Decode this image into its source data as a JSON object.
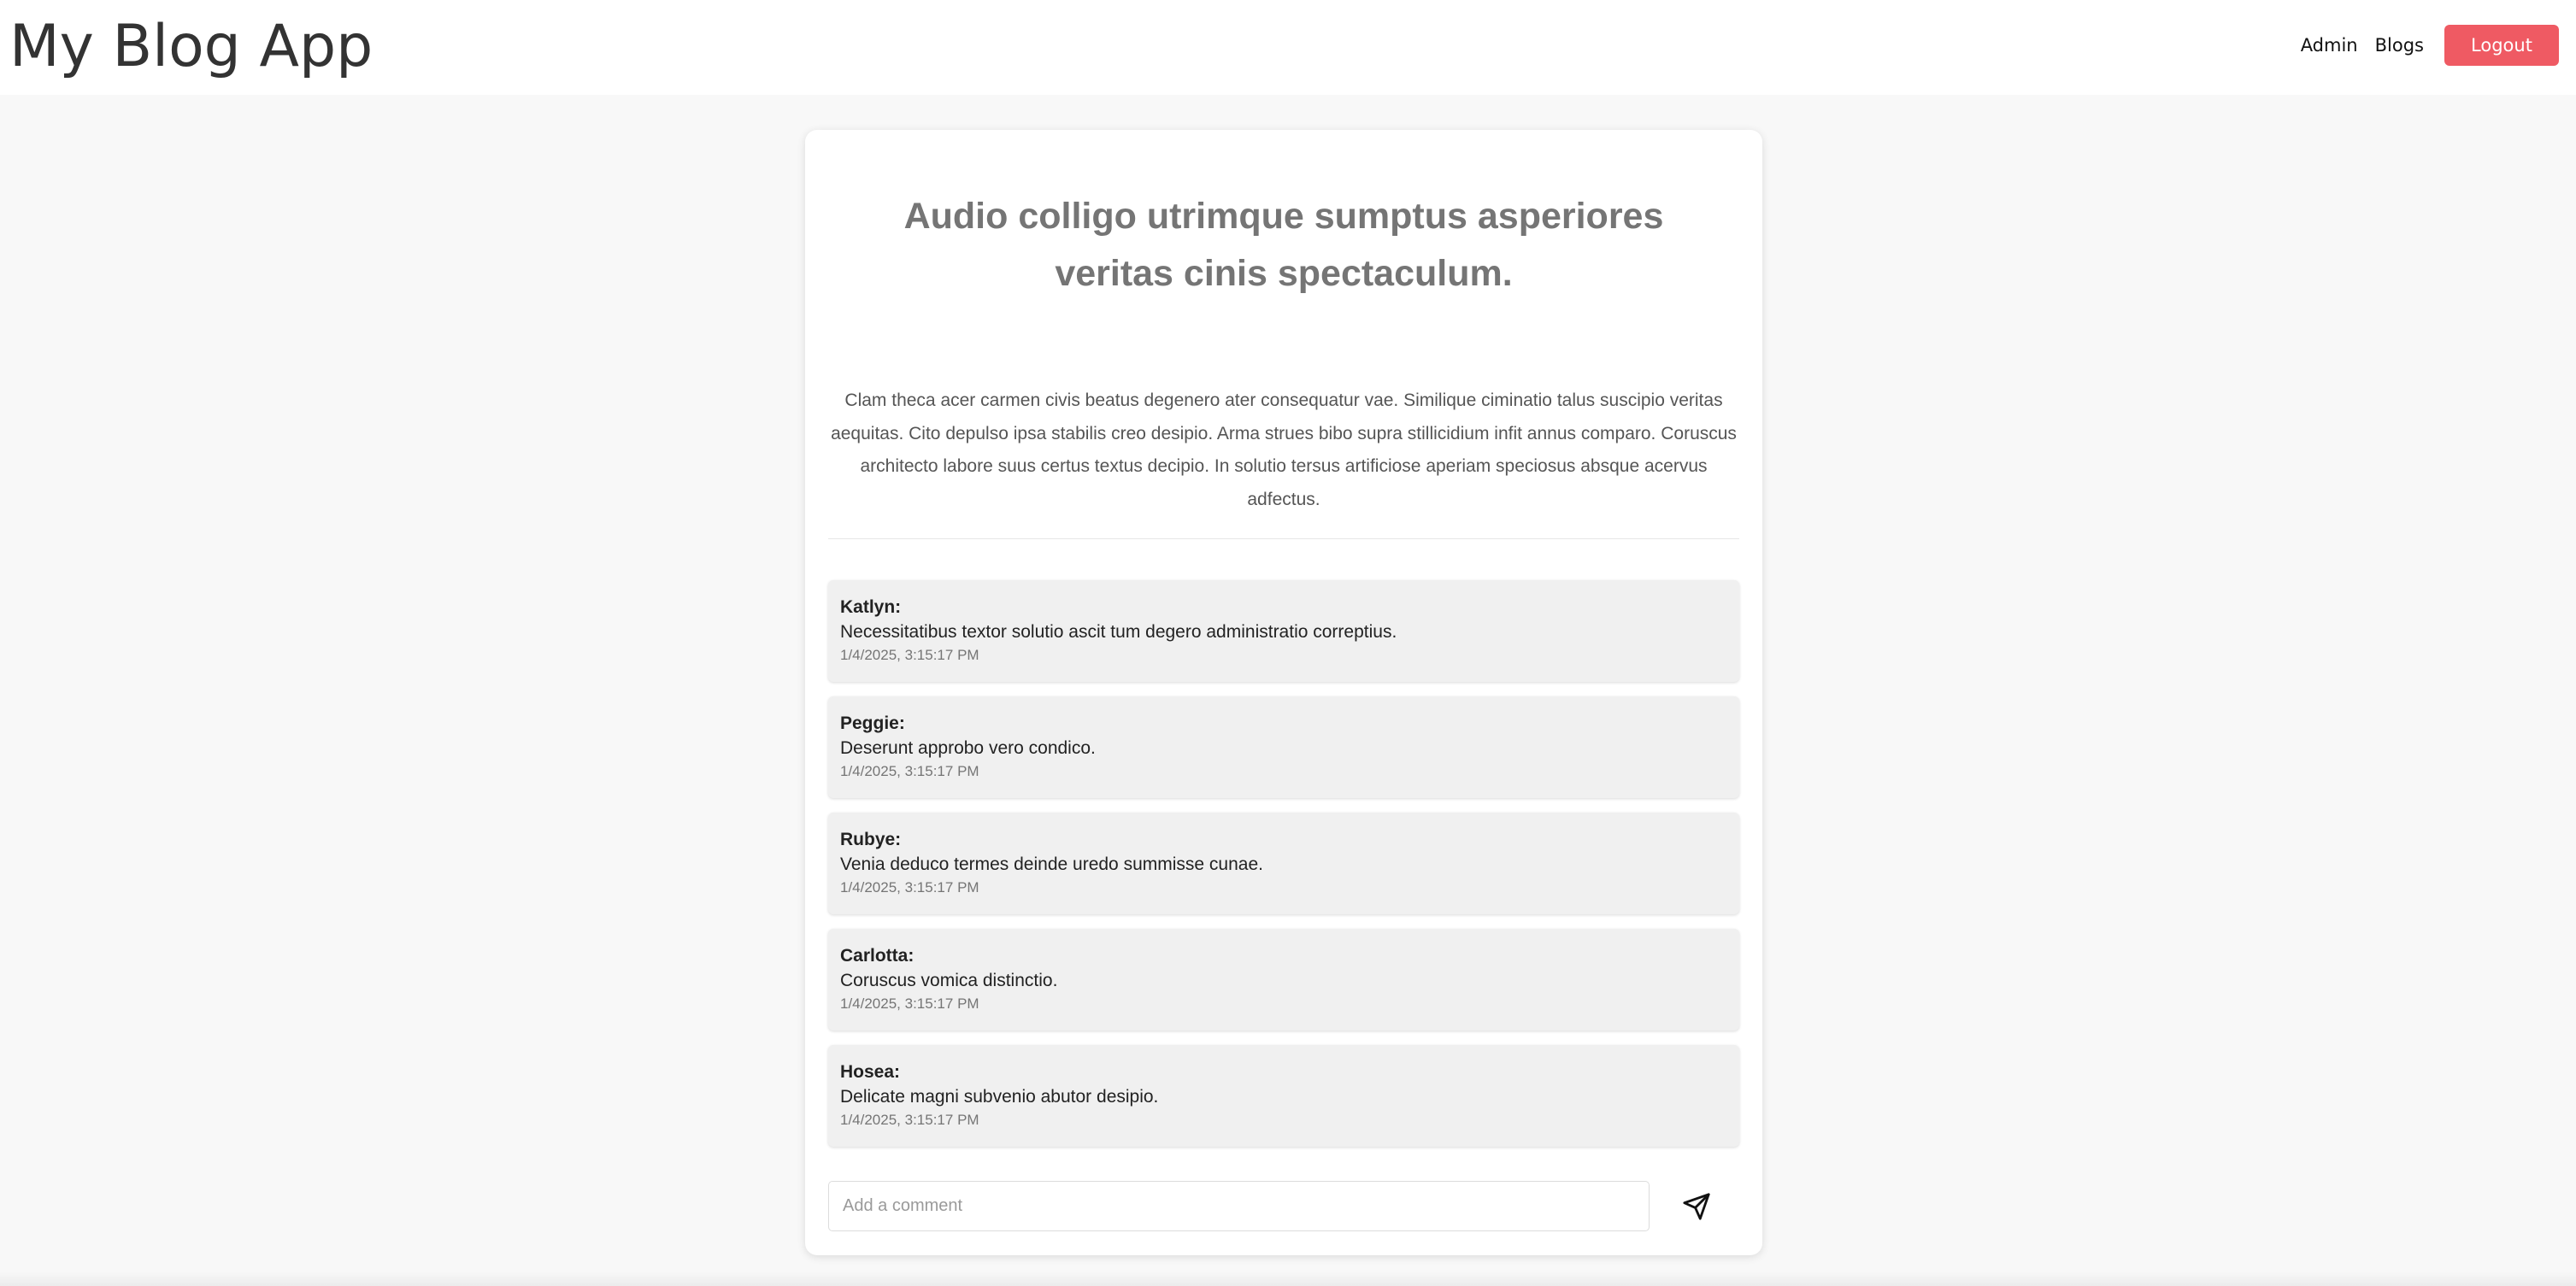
{
  "header": {
    "app_title": "My Blog App",
    "nav": {
      "admin_label": "Admin",
      "blogs_label": "Blogs",
      "logout_label": "Logout"
    }
  },
  "post": {
    "title": "Audio colligo utrimque sumptus asperiores veritas cinis spectaculum.",
    "body": "Clam theca acer carmen civis beatus degenero ater consequatur vae. Similique ciminatio talus suscipio veritas aequitas. Cito depulso ipsa stabilis creo desipio. Arma strues bibo supra stillicidium infit annus comparo. Coruscus architecto labore suus certus textus decipio. In solutio tersus artificiose aperiam speciosus absque acervus adfectus."
  },
  "comments": [
    {
      "author": "Katlyn:",
      "text": "Necessitatibus textor solutio ascit tum degero administratio correptius.",
      "time": "1/4/2025, 3:15:17 PM"
    },
    {
      "author": "Peggie:",
      "text": "Deserunt approbo vero condico.",
      "time": "1/4/2025, 3:15:17 PM"
    },
    {
      "author": "Rubye:",
      "text": "Venia deduco termes deinde uredo summisse cunae.",
      "time": "1/4/2025, 3:15:17 PM"
    },
    {
      "author": "Carlotta:",
      "text": "Coruscus vomica distinctio.",
      "time": "1/4/2025, 3:15:17 PM"
    },
    {
      "author": "Hosea:",
      "text": "Delicate magni subvenio abutor desipio.",
      "time": "1/4/2025, 3:15:17 PM"
    }
  ],
  "comment_form": {
    "placeholder": "Add a comment",
    "value": "",
    "send_icon": "send-icon"
  },
  "colors": {
    "logout_button": "#ef5a63",
    "page_background": "#f8f8f8",
    "card_background": "#ffffff",
    "comment_background": "#f0f0f0"
  }
}
